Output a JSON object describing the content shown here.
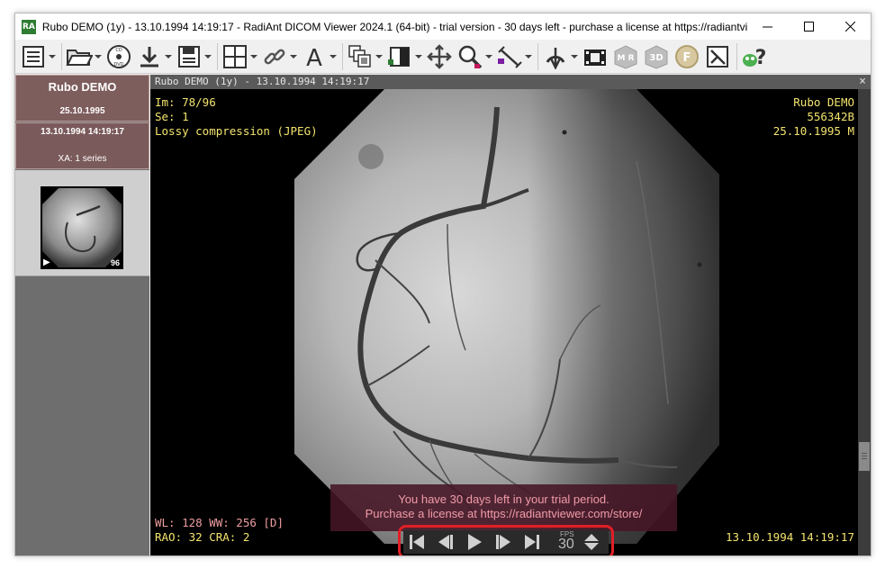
{
  "window": {
    "title": "Rubo DEMO (1y) - 13.10.1994 14:19:17 - RadiAnt DICOM Viewer 2024.1 (64-bit) - trial version - 30 days left - purchase a license at https://radiantview...",
    "app_icon": "RA"
  },
  "toolbar": {
    "buttons": [
      {
        "icon": "database-icon",
        "dropdown": true
      },
      {
        "icon": "open-folder-icon",
        "dropdown": true
      },
      {
        "icon": "cd-dvd-icon",
        "dropdown": false
      },
      {
        "icon": "download-icon",
        "dropdown": true
      },
      {
        "icon": "save-icon",
        "dropdown": true
      },
      {
        "icon": "layout-grid-icon",
        "dropdown": true
      },
      {
        "icon": "sync-link-icon",
        "dropdown": true
      },
      {
        "icon": "annotation-text-icon",
        "dropdown": true
      },
      {
        "icon": "series-stack-icon",
        "dropdown": true
      },
      {
        "icon": "window-level-icon",
        "dropdown": true
      },
      {
        "icon": "pan-icon",
        "dropdown": false
      },
      {
        "icon": "zoom-icon",
        "dropdown": true
      },
      {
        "icon": "measure-line-icon",
        "dropdown": true
      },
      {
        "icon": "rotate-flip-icon",
        "dropdown": true
      },
      {
        "icon": "cine-film-icon",
        "dropdown": false
      },
      {
        "icon": "mpr-icon",
        "dropdown": false
      },
      {
        "icon": "3d-icon",
        "dropdown": false
      },
      {
        "icon": "fusion-icon",
        "dropdown": false
      },
      {
        "icon": "reset-icon",
        "dropdown": false
      },
      {
        "icon": "help-icon",
        "dropdown": false
      }
    ],
    "cd_label": "CD",
    "dvd_label": "DVD",
    "annotation_letter": "A",
    "mpr_letters": "M R",
    "three_d_label": "3D",
    "fusion_letter": "F",
    "help_symbol": "?"
  },
  "patient_panel": {
    "patient_name": "Rubo DEMO",
    "patient_dob": "25.10.1995",
    "study_datetime": "13.10.1994 14:19:17",
    "study_series": "XA: 1 series",
    "thumbnail_count": "96",
    "thumbnail_play": "▶"
  },
  "viewer": {
    "header": "Rubo DEMO (1y) - 13.10.1994 14:19:17",
    "close": "×",
    "overlay_top_left": [
      "Im: 78/96",
      "Se: 1",
      "Lossy compression (JPEG)"
    ],
    "overlay_top_right": [
      "Rubo DEMO",
      "556342B",
      "25.10.1995 M"
    ],
    "overlay_bottom_left": [
      "WL: 128 WW: 256 [D]",
      "RAO: 32 CRA: 2"
    ],
    "overlay_bottom_right": "13.10.1994 14:19:17",
    "trial_message": [
      "You have 30 days left in your trial period.",
      "Purchase a license at https://radiantviewer.com/store/"
    ],
    "player": {
      "fps_label": "FPS",
      "fps_value": "30"
    }
  },
  "colors": {
    "overlay_yellow": "#f3e46d",
    "overlay_pink": "#ee9ea0",
    "highlight_red": "#e21f26",
    "patient_card": "#7e5d5d"
  }
}
